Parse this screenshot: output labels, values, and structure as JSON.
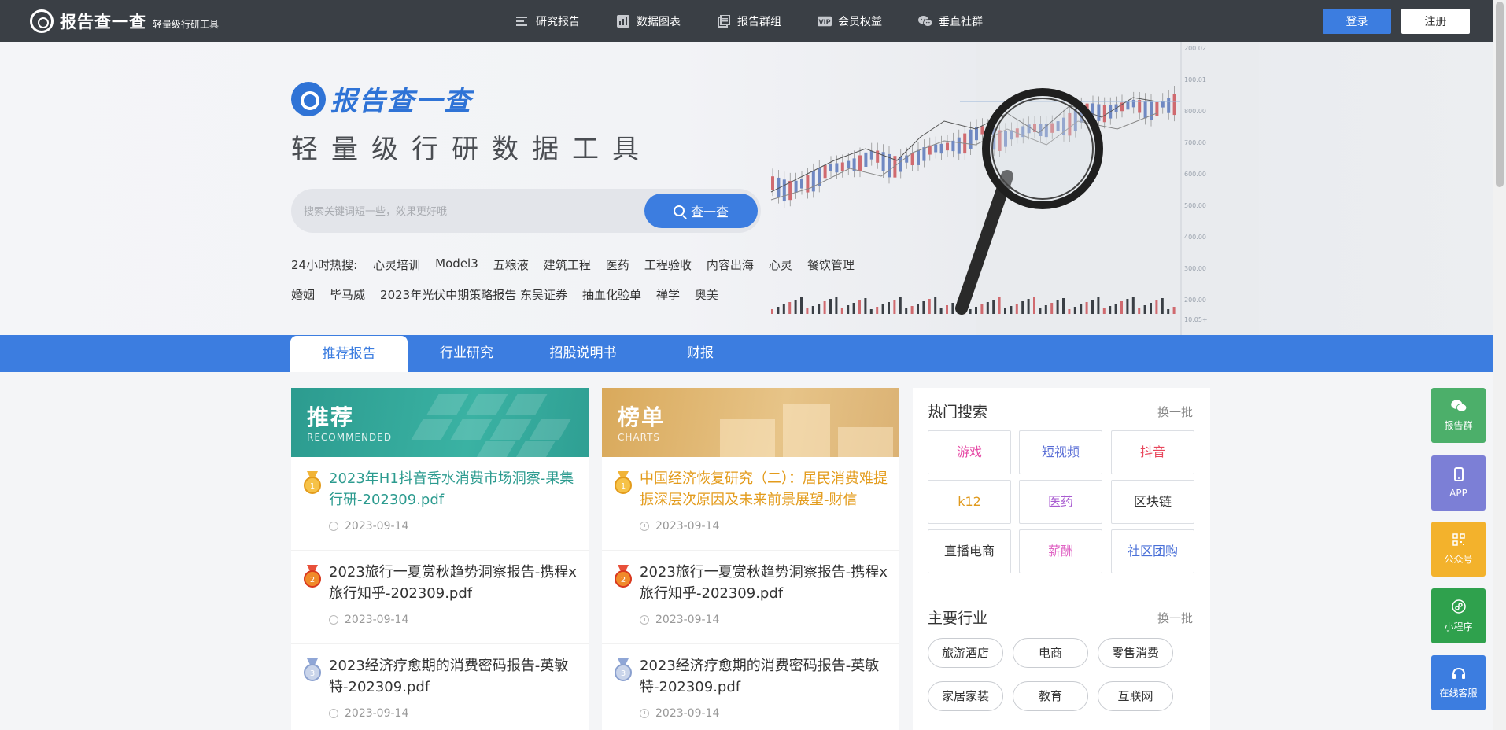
{
  "topbar": {
    "brand_name": "报告查一查",
    "brand_sub": "轻量级行研工具",
    "nav": [
      {
        "label": "研究报告",
        "icon": "list-icon"
      },
      {
        "label": "数据图表",
        "icon": "bar-chart-icon"
      },
      {
        "label": "报告群组",
        "icon": "document-group-icon"
      },
      {
        "label": "会员权益",
        "icon": "vip-icon"
      },
      {
        "label": "垂直社群",
        "icon": "wechat-icon"
      }
    ],
    "login": "登录",
    "register": "注册"
  },
  "hero": {
    "logo_text": "报告查一查",
    "tagline": "轻量级行研数据工具",
    "search_placeholder": "搜索关键词短一些，效果更好哦",
    "search_button": "查一查",
    "hot_label": "24小时热搜:",
    "hot_row1": [
      "心灵培训",
      "Model3",
      "五粮液",
      "建筑工程",
      "医药",
      "工程验收",
      "内容出海",
      "心灵",
      "餐饮管理"
    ],
    "hot_row2": [
      "婚姻",
      "毕马威",
      "2023年光伏中期策略报告 东吴证券",
      "抽血化验单",
      "禅学",
      "奥美"
    ]
  },
  "tabs": [
    "推荐报告",
    "行业研究",
    "招股说明书",
    "财报"
  ],
  "recommended": {
    "title": "推荐",
    "subtitle": "RECOMMENDED",
    "items": [
      {
        "title": "2023年H1抖音香水消费市场洞察-果集行研-202309.pdf",
        "date": "2023-09-14"
      },
      {
        "title": "2023旅行一夏赏秋趋势洞察报告-携程x旅行知乎-202309.pdf",
        "date": "2023-09-14"
      },
      {
        "title": "2023经济疗愈期的消费密码报告-英敏特-202309.pdf",
        "date": "2023-09-14"
      }
    ]
  },
  "ranking": {
    "title": "榜单",
    "subtitle": "CHARTS",
    "items": [
      {
        "title": "中国经济恢复研究（二）：居民消费难提振深层次原因及未来前景展望-财信",
        "date": "2023-09-14"
      },
      {
        "title": "2023旅行一夏赏秋趋势洞察报告-携程x旅行知乎-202309.pdf",
        "date": "2023-09-14"
      },
      {
        "title": "2023经济疗愈期的消费密码报告-英敏特-202309.pdf",
        "date": "2023-09-14"
      }
    ]
  },
  "hot_search": {
    "title": "热门搜索",
    "more": "换一批",
    "tags": [
      {
        "label": "游戏",
        "color": "#e64ba6"
      },
      {
        "label": "短视频",
        "color": "#5b6fd6"
      },
      {
        "label": "抖音",
        "color": "#e8475c"
      },
      {
        "label": "k12",
        "color": "#e09a1e"
      },
      {
        "label": "医药",
        "color": "#a85bd0"
      },
      {
        "label": "区块链",
        "color": "#333333"
      },
      {
        "label": "直播电商",
        "color": "#333333"
      },
      {
        "label": "薪酬",
        "color": "#e064c4"
      },
      {
        "label": "社区团购",
        "color": "#4a70d8"
      }
    ]
  },
  "industries": {
    "title": "主要行业",
    "more": "换一批",
    "tags": [
      "旅游酒店",
      "电商",
      "零售消费",
      "家居家装",
      "教育",
      "互联网"
    ]
  },
  "side": [
    {
      "label": "报告群",
      "color": "#4caf6a",
      "icon": "wechat-icon"
    },
    {
      "label": "APP",
      "color": "#7c7fd6",
      "icon": "phone-icon"
    },
    {
      "label": "公众号",
      "color": "#f3b22c",
      "icon": "qrcode-icon"
    },
    {
      "label": "小程序",
      "color": "#2fa14d",
      "icon": "mini-program-icon"
    },
    {
      "label": "在线客服",
      "color": "#3c7de0",
      "icon": "headset-icon"
    }
  ]
}
